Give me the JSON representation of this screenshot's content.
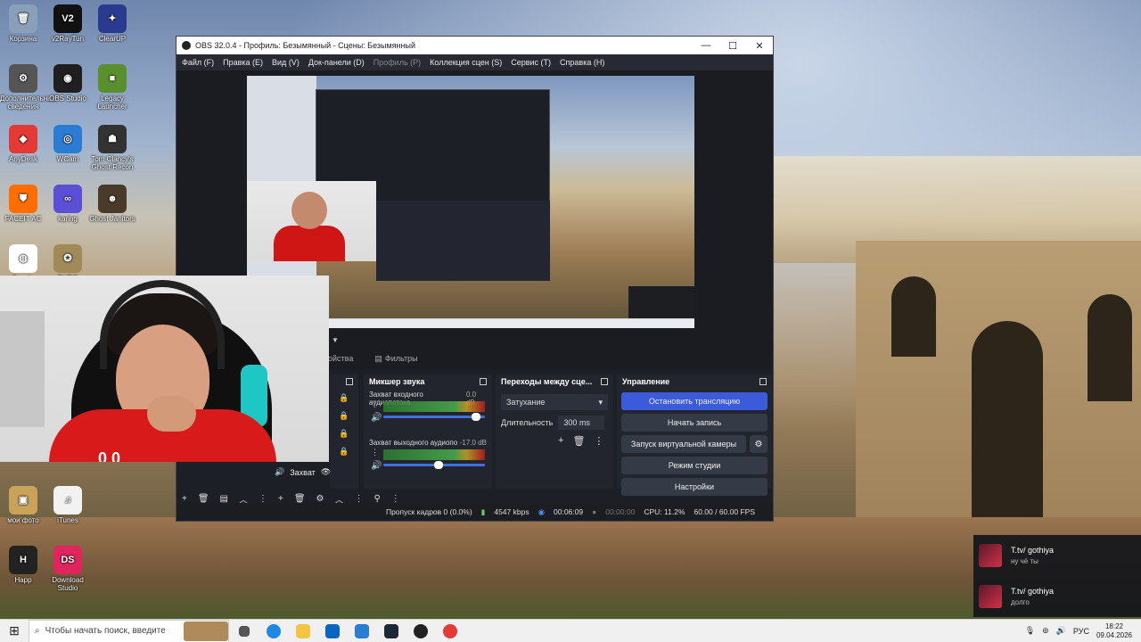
{
  "desktop": {
    "icons": [
      {
        "label": "Корзина",
        "color": "#8aa0b8",
        "glyph": "🗑"
      },
      {
        "label": "v2RayTun",
        "color": "#111111",
        "glyph": "V2"
      },
      {
        "label": "ClearUP",
        "color": "#2a3b8f",
        "glyph": "✦"
      },
      {
        "label": "Дополнительные сведения",
        "color": "#555555",
        "glyph": "⚙"
      },
      {
        "label": "OBS Studio",
        "color": "#1f1f1f",
        "glyph": "◉"
      },
      {
        "label": "Legacy Launcher",
        "color": "#5a8f2e",
        "glyph": "■"
      },
      {
        "label": "AnyDesk",
        "color": "#e53935",
        "glyph": "◆"
      },
      {
        "label": "WCam",
        "color": "#2b7cd3",
        "glyph": "◎"
      },
      {
        "label": "Tom Clancy's Ghost Recon",
        "color": "#333333",
        "glyph": "☗"
      },
      {
        "label": "FACEIT AC",
        "color": "#ff6d00",
        "glyph": "⛊"
      },
      {
        "label": "karing",
        "color": "#5b4fd6",
        "glyph": "∞"
      },
      {
        "label": "Ghost Janitors",
        "color": "#4a3a2a",
        "glyph": "☻"
      },
      {
        "label": "Google Chrome",
        "color": "#ffffff",
        "glyph": "◍"
      },
      {
        "label": "PUBG",
        "color": "#a08a5a",
        "glyph": "✪"
      },
      {
        "label": "мои фото",
        "color": "#c9a35a",
        "glyph": "▣"
      },
      {
        "label": "iTunes",
        "color": "#f2f2f2",
        "glyph": "♫"
      },
      {
        "label": "Happ",
        "color": "#222222",
        "glyph": "H"
      },
      {
        "label": "Download Studio",
        "color": "#e0245e",
        "glyph": "DS"
      }
    ]
  },
  "obs": {
    "title": "OBS 32.0.4 - Профиль: Безымянный - Сцены: Безымянный",
    "window_controls": [
      "—",
      "☐",
      "✕"
    ],
    "menu": [
      {
        "label": "Файл (F)",
        "enabled": true
      },
      {
        "label": "Правка (E)",
        "enabled": true
      },
      {
        "label": "Вид (V)",
        "enabled": true
      },
      {
        "label": "Док-панели (D)",
        "enabled": true
      },
      {
        "label": "Профиль (P)",
        "enabled": false
      },
      {
        "label": "Коллекция сцен (S)",
        "enabled": true
      },
      {
        "label": "Сервис (T)",
        "enabled": true
      },
      {
        "label": "Справка (H)",
        "enabled": true
      }
    ],
    "tabs": {
      "properties": "ойства",
      "filters": "Фильтры"
    },
    "mixer": {
      "title": "Микшер звука",
      "channels": [
        {
          "name": "Захват входного аудиопотока",
          "db": "0.0 dB",
          "volume": 0.95
        },
        {
          "name": "Захват выходного аудиопо",
          "db": "-17.0 dB",
          "volume": 0.55
        }
      ]
    },
    "transitions": {
      "title": "Переходы между сце...",
      "selected": "Затухание",
      "duration_label": "Длительность",
      "duration_value": "300 ms"
    },
    "controls": {
      "title": "Управление",
      "stop_stream": "Остановить трансляцию",
      "start_record": "Начать запись",
      "virtual_cam": "Запуск виртуальной камеры",
      "studio_mode": "Режим студии",
      "settings": "Настройки"
    },
    "source_partial": "Захват",
    "status": {
      "dropped": "Пропуск кадров 0 (0.0%)",
      "bitrate": "4547 kbps",
      "stream_time": "00:06:09",
      "record_time": "00:00:00",
      "cpu": "CPU: 11.2%",
      "fps": "60.00 / 60.00 FPS"
    }
  },
  "chat": {
    "messages": [
      {
        "user": "T.tv/ gothiya",
        "text": "ну чё ты"
      },
      {
        "user": "T.tv/ gothiya",
        "text": "долго"
      }
    ]
  },
  "webcam": {
    "shirt_text": "0 0"
  },
  "taskbar": {
    "search_placeholder": "Чтобы начать поиск, введите",
    "lang": "РУС",
    "time": "18:22",
    "date": "09.04.2026"
  }
}
